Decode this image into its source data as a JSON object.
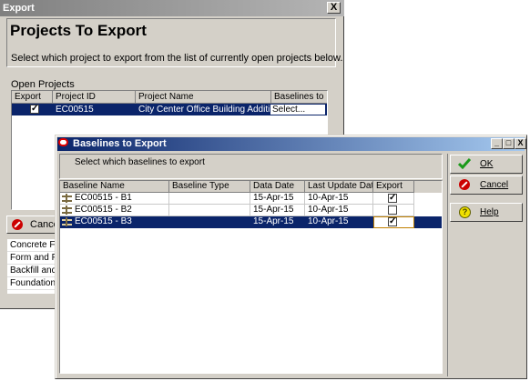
{
  "back_window": {
    "title": "Export",
    "close_glyph": "X",
    "page_title": "Projects To Export",
    "description": "Select which project to export from the list of currently open projects below.",
    "open_projects_label": "Open Projects",
    "columns": [
      "Export",
      "Project ID",
      "Project Name",
      "Baselines to Ex"
    ],
    "rows": [
      {
        "export": true,
        "project_id": "EC00515",
        "project_name": "City Center Office Building Addition",
        "baselines": "Select..."
      }
    ],
    "cancel_label": "Cancel",
    "behind_list": [
      "Concrete Fou",
      "Form and Pou",
      "Backfill and C",
      "Foundation P"
    ]
  },
  "dialog": {
    "title": "Baselines to Export",
    "description": "Select which baselines to export",
    "columns": [
      "Baseline Name",
      "Baseline Type",
      "Data Date",
      "Last Update Date",
      "Export"
    ],
    "rows": [
      {
        "name": "EC00515 - B1",
        "type": "",
        "data_date": "15-Apr-15",
        "last_update": "10-Apr-15",
        "export": true,
        "selected": false
      },
      {
        "name": "EC00515 - B2",
        "type": "",
        "data_date": "15-Apr-15",
        "last_update": "10-Apr-15",
        "export": false,
        "selected": false
      },
      {
        "name": "EC00515 - B3",
        "type": "",
        "data_date": "15-Apr-15",
        "last_update": "10-Apr-15",
        "export": true,
        "selected": true
      }
    ],
    "buttons": {
      "ok": "OK",
      "cancel": "Cancel",
      "help": "Help"
    },
    "window_controls": {
      "minimize": "_",
      "maximize": "□",
      "close": "X"
    },
    "colors": {
      "title_bar": "#0a246a",
      "selection": "#0a246a"
    }
  }
}
